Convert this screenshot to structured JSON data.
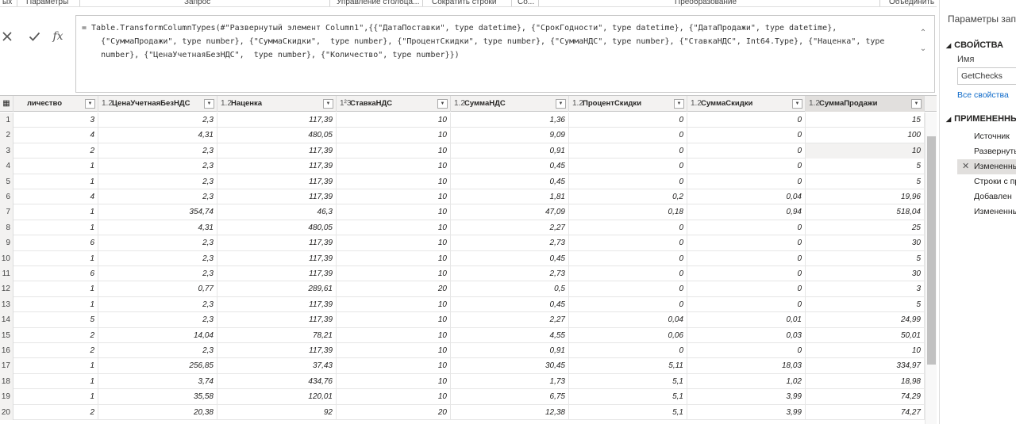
{
  "ribbon": {
    "groups": [
      "ых",
      "Параметры",
      "Запрос",
      "Управление столбца...",
      "Сократить строки",
      "Со...",
      "Преобразование",
      "Объединить"
    ]
  },
  "formula": {
    "cancel_icon": "close-icon",
    "commit_icon": "check-icon",
    "fx_label": "fx",
    "text": "= Table.TransformColumnTypes(#\"Развернутый элемент Column1\",{{\"ДатаПоставки\", type datetime}, {\"СрокГодности\", type datetime}, {\"ДатаПродажи\", type datetime},\n    {\"СуммаПродажи\", type number}, {\"СуммаСкидки\",  type number}, {\"ПроцентСкидки\", type number}, {\"СуммаНДС\", type number}, {\"СтавкаНДС\", Int64.Type}, {\"Наценка\", type\n    number}, {\"ЦенаУчетнаяБезНДС\",  type number}, {\"Количество\", type number}})",
    "scroll_up": "⌃",
    "scroll_down": "⌄"
  },
  "grid": {
    "corner": "▦",
    "columns": [
      {
        "type": "",
        "label": "личество"
      },
      {
        "type": "1.2",
        "label": "ЦенаУчетнаяБезНДС"
      },
      {
        "type": "1.2",
        "label": "Наценка"
      },
      {
        "type": "1²3",
        "label": "СтавкаНДС"
      },
      {
        "type": "1.2",
        "label": "СуммаНДС"
      },
      {
        "type": "1.2",
        "label": "ПроцентСкидки"
      },
      {
        "type": "1.2",
        "label": "СуммаСкидки"
      },
      {
        "type": "1.2",
        "label": "СуммаПродажи"
      }
    ],
    "dropdown_glyph": "▼",
    "rows": [
      [
        "1",
        "3",
        "2,3",
        "117,39",
        "10",
        "1,36",
        "0",
        "0",
        "15"
      ],
      [
        "2",
        "4",
        "4,31",
        "480,05",
        "10",
        "9,09",
        "0",
        "0",
        "100"
      ],
      [
        "3",
        "2",
        "2,3",
        "117,39",
        "10",
        "0,91",
        "0",
        "0",
        "10"
      ],
      [
        "4",
        "1",
        "2,3",
        "117,39",
        "10",
        "0,45",
        "0",
        "0",
        "5"
      ],
      [
        "5",
        "1",
        "2,3",
        "117,39",
        "10",
        "0,45",
        "0",
        "0",
        "5"
      ],
      [
        "6",
        "4",
        "2,3",
        "117,39",
        "10",
        "1,81",
        "0,2",
        "0,04",
        "19,96"
      ],
      [
        "7",
        "1",
        "354,74",
        "46,3",
        "10",
        "47,09",
        "0,18",
        "0,94",
        "518,04"
      ],
      [
        "8",
        "1",
        "4,31",
        "480,05",
        "10",
        "2,27",
        "0",
        "0",
        "25"
      ],
      [
        "9",
        "6",
        "2,3",
        "117,39",
        "10",
        "2,73",
        "0",
        "0",
        "30"
      ],
      [
        "10",
        "1",
        "2,3",
        "117,39",
        "10",
        "0,45",
        "0",
        "0",
        "5"
      ],
      [
        "11",
        "6",
        "2,3",
        "117,39",
        "10",
        "2,73",
        "0",
        "0",
        "30"
      ],
      [
        "12",
        "1",
        "0,77",
        "289,61",
        "20",
        "0,5",
        "0",
        "0",
        "3"
      ],
      [
        "13",
        "1",
        "2,3",
        "117,39",
        "10",
        "0,45",
        "0",
        "0",
        "5"
      ],
      [
        "14",
        "5",
        "2,3",
        "117,39",
        "10",
        "2,27",
        "0,04",
        "0,01",
        "24,99"
      ],
      [
        "15",
        "2",
        "14,04",
        "78,21",
        "10",
        "4,55",
        "0,06",
        "0,03",
        "50,01"
      ],
      [
        "16",
        "2",
        "2,3",
        "117,39",
        "10",
        "0,91",
        "0",
        "0",
        "10"
      ],
      [
        "17",
        "1",
        "256,85",
        "37,43",
        "10",
        "30,45",
        "5,11",
        "18,03",
        "334,97"
      ],
      [
        "18",
        "1",
        "3,74",
        "434,76",
        "10",
        "1,73",
        "5,1",
        "1,02",
        "18,98"
      ],
      [
        "19",
        "1",
        "35,58",
        "120,01",
        "10",
        "6,75",
        "5,1",
        "3,99",
        "74,29"
      ],
      [
        "20",
        "2",
        "20,38",
        "92",
        "20",
        "12,38",
        "5,1",
        "3,99",
        "74,27"
      ]
    ]
  },
  "panel": {
    "title": "Параметры запр",
    "properties_heading": "СВОЙСТВА",
    "name_label": "Имя",
    "name_value": "GetChecks",
    "all_properties_link": "Все свойства",
    "steps_heading": "ПРИМЕНЕННЫЕ",
    "steps": [
      "Источник",
      "Развернутый",
      "Измененный",
      "Строки с пр",
      "Добавлен",
      "Измененный"
    ],
    "active_step_icon": "✕"
  }
}
